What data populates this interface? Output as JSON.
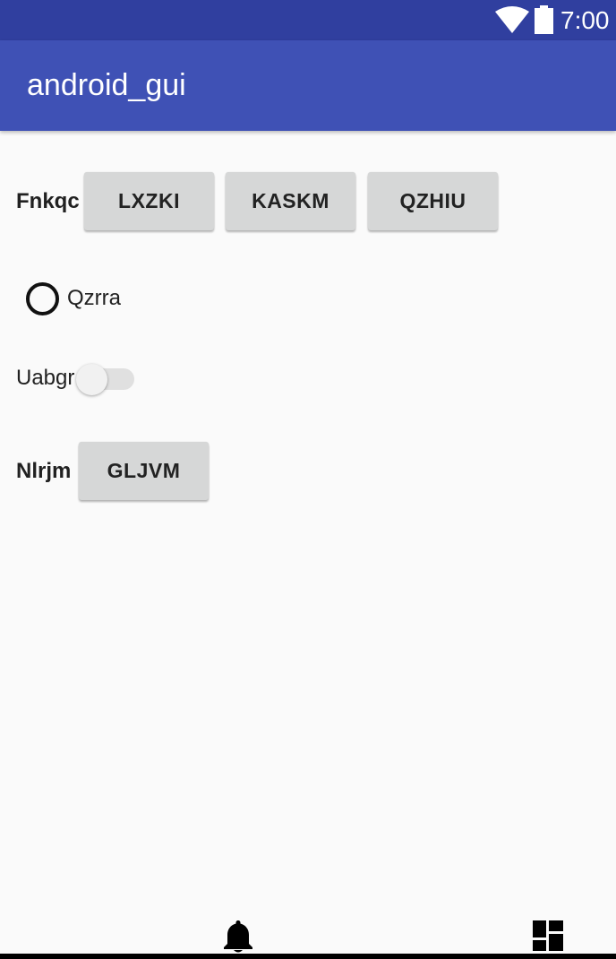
{
  "status_bar": {
    "time": "7:00",
    "wifi_icon": "wifi-icon",
    "battery_icon": "battery-icon",
    "background_color": "#303f9f"
  },
  "app_bar": {
    "title": "android_gui",
    "background_color": "#3f51b5"
  },
  "row1": {
    "label": "Fnkqc",
    "buttons": [
      "LXZKI",
      "KASKM",
      "QZHIU"
    ]
  },
  "radio": {
    "label": "Qzrra",
    "checked": false
  },
  "switch": {
    "label": "Uabgr",
    "on": false
  },
  "row4": {
    "label": "Nlrjm",
    "button": "GLJVM"
  },
  "bottom_icons": [
    "bell-icon",
    "dashboard-icon"
  ]
}
